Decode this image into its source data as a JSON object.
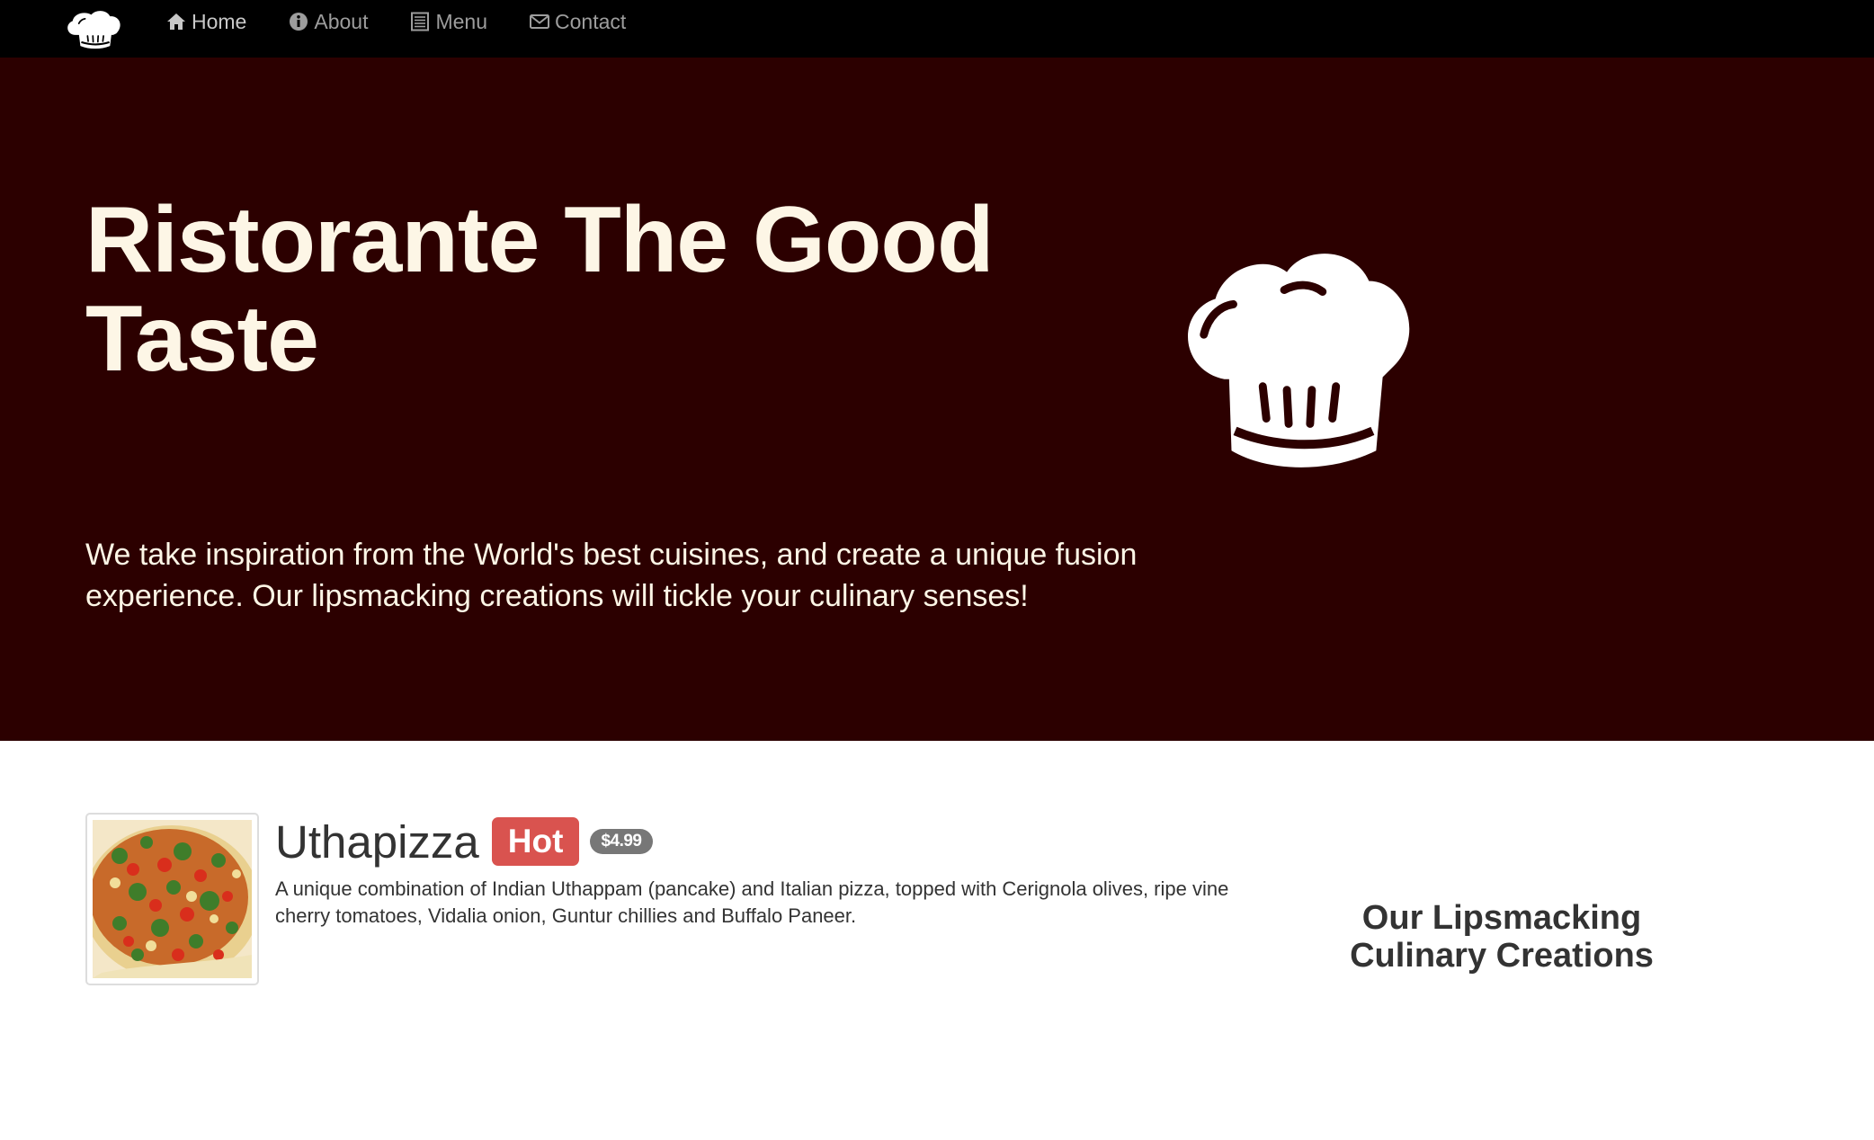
{
  "navbar": {
    "logo": "chef-hat-logo",
    "items": [
      {
        "label": "Home",
        "icon": "home-icon",
        "active": true
      },
      {
        "label": "About",
        "icon": "info-circle-icon",
        "active": false
      },
      {
        "label": "Menu",
        "icon": "list-alt-icon",
        "active": false
      },
      {
        "label": "Contact",
        "icon": "envelope-icon",
        "active": false
      }
    ]
  },
  "jumbotron": {
    "title": "Ristorante The Good Taste",
    "text": "We take inspiration from the World's best cuisines, and create a unique fusion experience. Our lipsmacking creations will tickle your culinary senses!",
    "logo": "chef-hat-logo",
    "background_color": "#2c0000",
    "text_color": "#fdf6e6"
  },
  "dish": {
    "image": "pizza-image",
    "name": "Uthapizza",
    "label": "Hot",
    "price": "$4.99",
    "description": "A unique combination of Indian Uthappam (pancake) and Italian pizza, topped with Cerignola olives, ripe vine cherry tomatoes, Vidalia onion, Guntur chillies and Buffalo Paneer.",
    "label_color": "#d9534f",
    "badge_color": "#777777"
  },
  "side": {
    "heading": "Our Lipsmacking Culinary Creations"
  }
}
